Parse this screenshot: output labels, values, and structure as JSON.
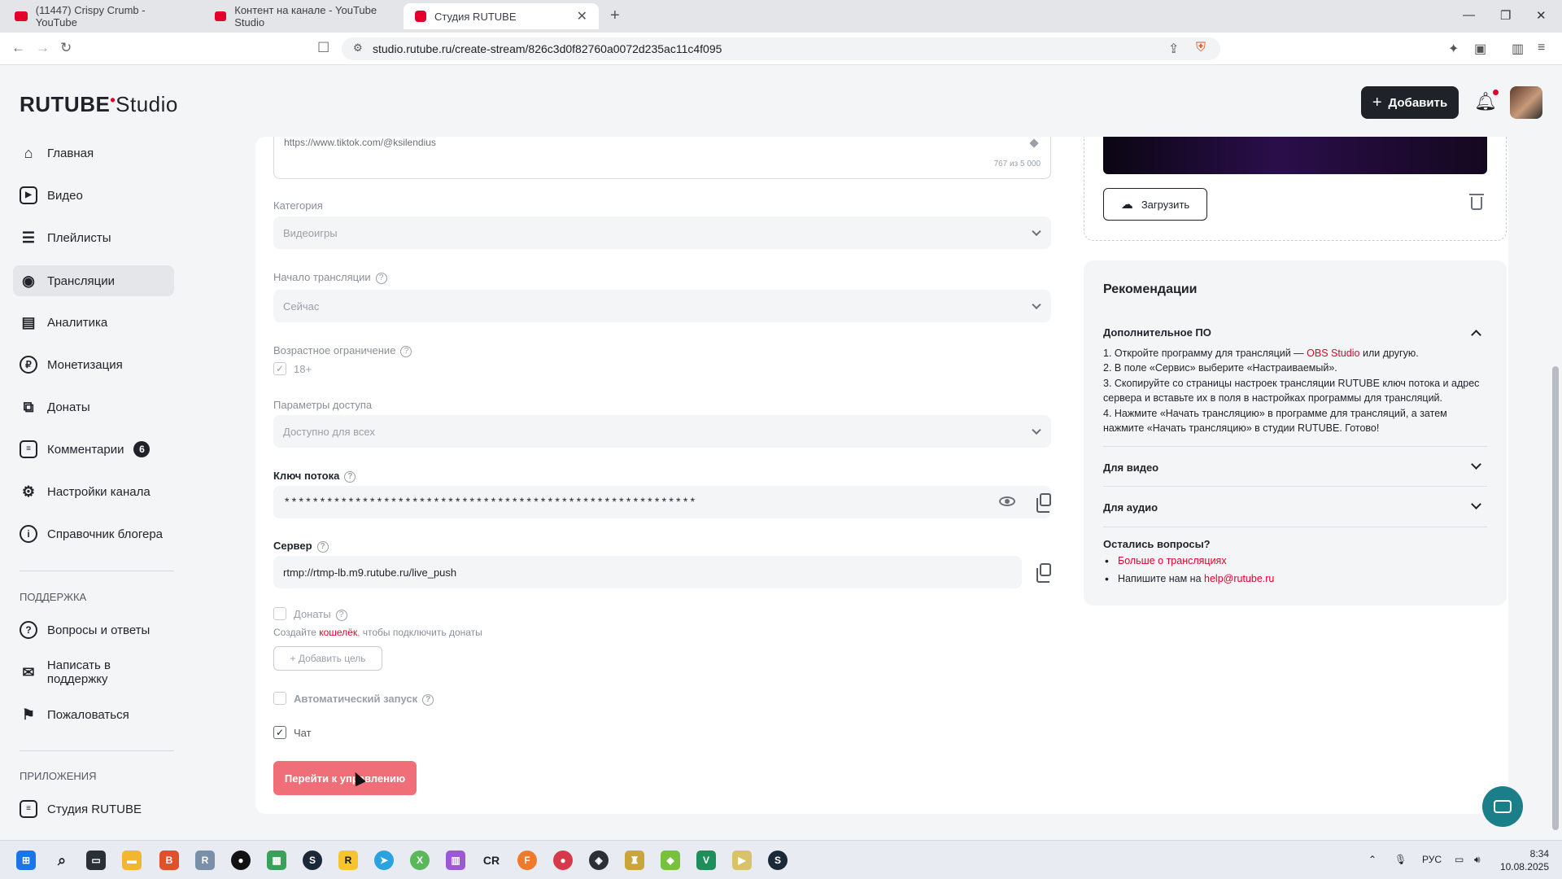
{
  "browser": {
    "tabs": [
      {
        "label": "(11447) Crispy Crumb - YouTube"
      },
      {
        "label": "Контент на канале - YouTube Studio"
      },
      {
        "label": "Студия RUTUBE"
      }
    ],
    "url": "studio.rutube.ru/create-stream/826c3d0f82760a0072d235ac11c4f095"
  },
  "header": {
    "logo_main": "RUTUBE",
    "logo_sub": "Studio",
    "add_button": "Добавить"
  },
  "sidebar": {
    "items": [
      {
        "label": "Главная"
      },
      {
        "label": "Видео"
      },
      {
        "label": "Плейлисты"
      },
      {
        "label": "Трансляции"
      },
      {
        "label": "Аналитика"
      },
      {
        "label": "Монетизация"
      },
      {
        "label": "Донаты"
      },
      {
        "label": "Комментарии",
        "badge": "6"
      },
      {
        "label": "Настройки канала"
      },
      {
        "label": "Справочник блогера"
      }
    ],
    "support_heading": "ПОДДЕРЖКА",
    "support_items": [
      {
        "label": "Вопросы и ответы"
      },
      {
        "label": "Написать в поддержку"
      },
      {
        "label": "Пожаловаться"
      }
    ],
    "apps_heading": "ПРИЛОЖЕНИЯ",
    "apps_items": [
      {
        "label": "Студия RUTUBE"
      }
    ]
  },
  "form": {
    "description_tail": "https://www.tiktok.com/@ksilendius",
    "description_counter": "767 из 5 000",
    "category": {
      "label": "Категория",
      "value": "Видеоигры"
    },
    "start": {
      "label": "Начало трансляции",
      "value": "Сейчас"
    },
    "age": {
      "label": "Возрастное ограничение",
      "checkbox_label": "18+",
      "checked": true
    },
    "access": {
      "label": "Параметры доступа",
      "value": "Доступно для всех"
    },
    "stream_key": {
      "label": "Ключ потока",
      "masked": "**********************************************************"
    },
    "server": {
      "label": "Сервер",
      "value": "rtmp://rtmp-lb.m9.rutube.ru/live_push"
    },
    "donations": {
      "label": "Донаты",
      "hint_before": "Создайте",
      "hint_link": "кошелёк",
      "hint_after": ", чтобы подключить донаты",
      "add_goal": "+ Добавить цель",
      "checked": false
    },
    "autostart": {
      "label": "Автоматический запуск",
      "checked": false
    },
    "chat": {
      "label": "Чат",
      "checked": true
    },
    "submit": "Перейти к управлению"
  },
  "cover": {
    "upload_button": "Загрузить"
  },
  "recommendations": {
    "title": "Рекомендации",
    "sections": [
      {
        "title": "Дополнительное ПО",
        "expanded": true
      },
      {
        "title": "Для видео",
        "expanded": false
      },
      {
        "title": "Для аудио",
        "expanded": false
      }
    ],
    "steps": {
      "s1_before": "1. Откройте программу для трансляций —",
      "s1_link": "OBS Studio",
      "s1_after": "или другую.",
      "s2": "2. В поле «Сервис» выберите «Настраиваемый».",
      "s3": "3. Скопируйте со страницы настроек трансляции RUTUBE ключ потока и адрес сервера и вставьте их в поля в настройках программы для трансляций.",
      "s4": "4. Нажмите «Начать трансляцию» в программе для трансляций, а затем нажмите «Начать трансляцию» в студии RUTUBE. Готово!"
    },
    "questions_title": "Остались вопросы?",
    "more_link": "Больше о трансляциях",
    "write_before": "Напишите нам на",
    "write_link": "help@rutube.ru"
  },
  "taskbar": {
    "lang": "РУС",
    "time": "8:34",
    "date": "10.08.2025"
  },
  "colors": {
    "accent": "#e3002b",
    "primary_button": "#ef6e78",
    "dark": "#1f2329"
  }
}
